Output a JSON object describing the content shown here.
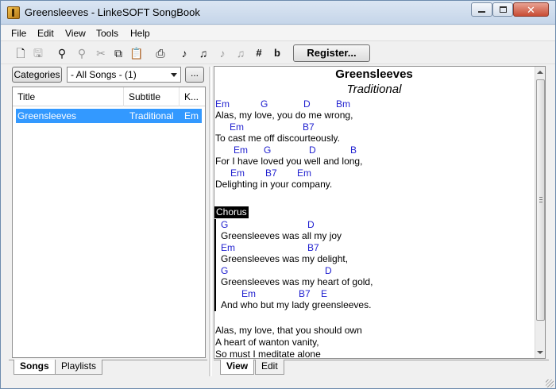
{
  "window": {
    "title": "Greensleeves - LinkeSOFT SongBook",
    "controls": {
      "minimize": "minimize",
      "maximize": "maximize",
      "close": "close"
    }
  },
  "menu": {
    "items": [
      "File",
      "Edit",
      "View",
      "Tools",
      "Help"
    ]
  },
  "toolbar": {
    "icons": [
      "new-document-icon",
      "save-icon",
      "find-icon",
      "find-replace-icon",
      "cut-icon",
      "copy-icon",
      "paste-icon",
      "print-icon",
      "transpose-down-icon",
      "transpose-up-icon",
      "transpose-down-disabled-icon",
      "transpose-up-disabled-icon",
      "sharp-icon",
      "flat-icon"
    ],
    "sharp_label": "#",
    "flat_label": "b",
    "register_label": "Register..."
  },
  "left_pane": {
    "categories_label": "Categories",
    "songs_filter": "- All Songs - (1)",
    "more_label": "...",
    "columns": [
      "Title",
      "Subtitle",
      "K..."
    ],
    "rows": [
      {
        "title": "Greensleeves",
        "subtitle": "Traditional",
        "key": "Em"
      }
    ],
    "tabs": [
      "Songs",
      "Playlists"
    ]
  },
  "song": {
    "title": "Greensleeves",
    "subtitle": "Traditional",
    "verse1": [
      {
        "chords": [
          [
            "Em",
            0
          ],
          [
            "G",
            57
          ],
          [
            "D",
            111
          ],
          [
            "Bm",
            152
          ]
        ],
        "lyric": "Alas, my love, you do me wrong,"
      },
      {
        "chords": [
          [
            "Em",
            18
          ],
          [
            "B7",
            110
          ]
        ],
        "lyric": "To cast me off discourteously."
      },
      {
        "chords": [
          [
            "Em",
            23
          ],
          [
            "G",
            61
          ],
          [
            "D",
            118
          ],
          [
            "B",
            170
          ]
        ],
        "lyric": "For I have loved you well and long,"
      },
      {
        "chords": [
          [
            "Em",
            19
          ],
          [
            "B7",
            63
          ],
          [
            "Em",
            103
          ]
        ],
        "lyric": "Delighting in your company."
      }
    ],
    "chorus_label": "Chorus",
    "chorus": [
      {
        "chords": [
          [
            "G",
            0
          ],
          [
            "D",
            109
          ]
        ],
        "lyric": "Greensleeves was all my joy"
      },
      {
        "chords": [
          [
            "Em",
            0
          ],
          [
            "B7",
            109
          ]
        ],
        "lyric": "Greensleeves was my delight,"
      },
      {
        "chords": [
          [
            "G",
            0
          ],
          [
            "D",
            131
          ]
        ],
        "lyric": "Greensleeves was my heart of gold,"
      },
      {
        "chords": [
          [
            "Em",
            26
          ],
          [
            "B7",
            98
          ],
          [
            "E",
            126
          ]
        ],
        "lyric": "And who but my lady greensleeves."
      }
    ],
    "verse2": [
      "Alas, my love, that you should own",
      "A heart of wanton vanity,",
      "So must I meditate alone"
    ]
  },
  "right_pane": {
    "tabs": [
      "View",
      "Edit"
    ]
  }
}
